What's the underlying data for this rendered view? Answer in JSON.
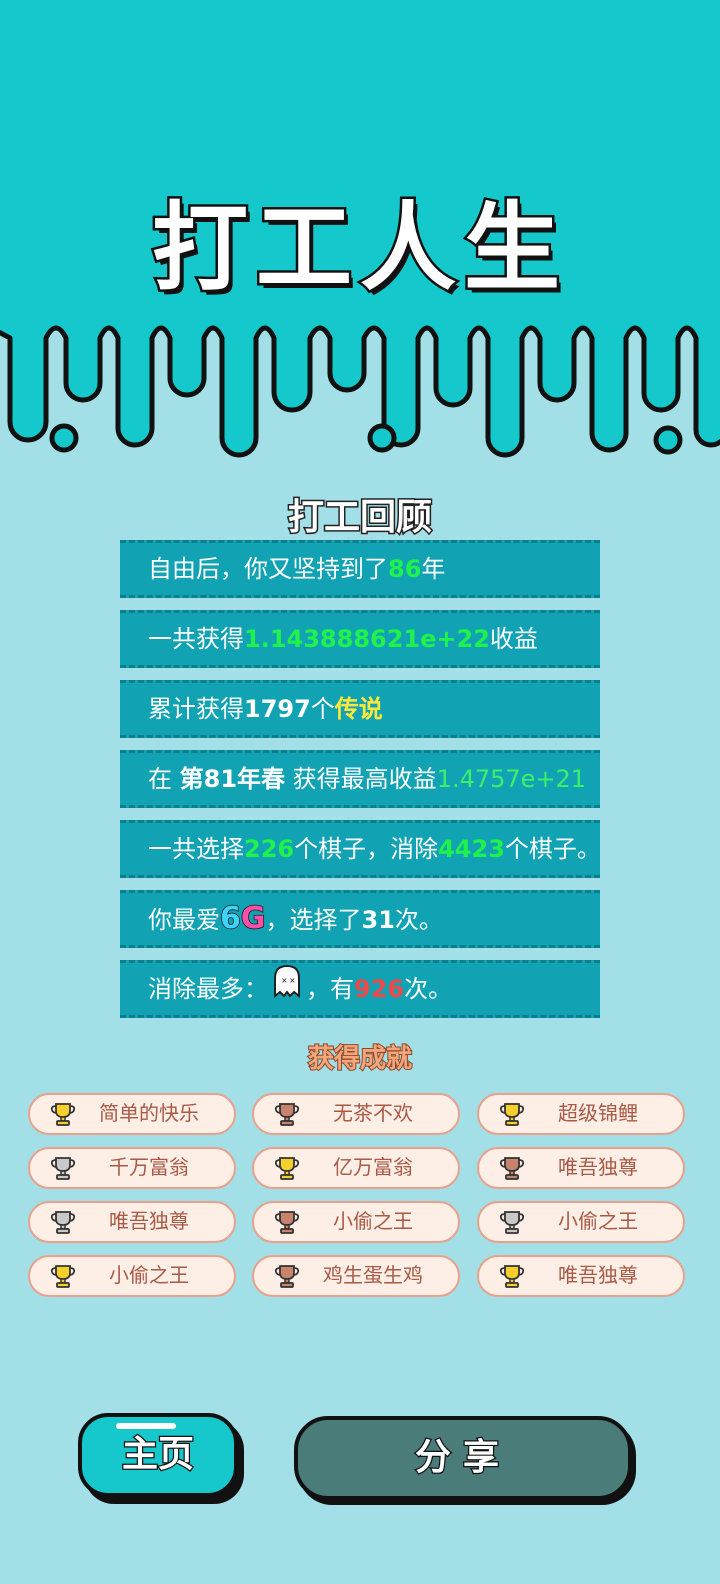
{
  "app_title": "打工人生",
  "review_title": "打工回顾",
  "stats": {
    "row1": {
      "pre": "自由后，你又坚持到了",
      "years": "86",
      "post": "年"
    },
    "row2": {
      "pre": "一共获得",
      "income": "1.143888621e+22",
      "post": "收益"
    },
    "row3": {
      "pre": "累计获得",
      "count": "1797",
      "mid": "个",
      "tier": "传说"
    },
    "row4": {
      "pre": "在 ",
      "period": "第81年春",
      "mid": " 获得最高收益",
      "value": "1.4757e+21"
    },
    "row5": {
      "pre": "一共选择",
      "chosen": "226",
      "mid": "个棋子，消除",
      "eliminated": "4423",
      "post": "个棋子。"
    },
    "row6": {
      "pre": "你最爱",
      "fav_a": "6",
      "fav_b": "G",
      "mid": "，选择了",
      "times": "31",
      "post": "次。"
    },
    "row7": {
      "pre": "消除最多：",
      "icon": "ghost-icon",
      "mid": "，有",
      "times": "926",
      "post": "次。"
    }
  },
  "achievements_title": "获得成就",
  "achievements": [
    {
      "label": "简单的快乐",
      "trophy": "gold"
    },
    {
      "label": "无茶不欢",
      "trophy": "bronze"
    },
    {
      "label": "超级锦鲤",
      "trophy": "gold"
    },
    {
      "label": "千万富翁",
      "trophy": "silver"
    },
    {
      "label": "亿万富翁",
      "trophy": "gold"
    },
    {
      "label": "唯吾独尊",
      "trophy": "bronze"
    },
    {
      "label": "唯吾独尊",
      "trophy": "silver"
    },
    {
      "label": "小偷之王",
      "trophy": "bronze"
    },
    {
      "label": "小偷之王",
      "trophy": "silver"
    },
    {
      "label": "小偷之王",
      "trophy": "gold"
    },
    {
      "label": "鸡生蛋生鸡",
      "trophy": "bronze"
    },
    {
      "label": "唯吾独尊",
      "trophy": "gold"
    }
  ],
  "trophy_colors": {
    "gold": "#f7cf2d",
    "silver": "#c9c9c9",
    "bronze": "#c7836b"
  },
  "buttons": {
    "home": "主页",
    "share": "分享"
  }
}
